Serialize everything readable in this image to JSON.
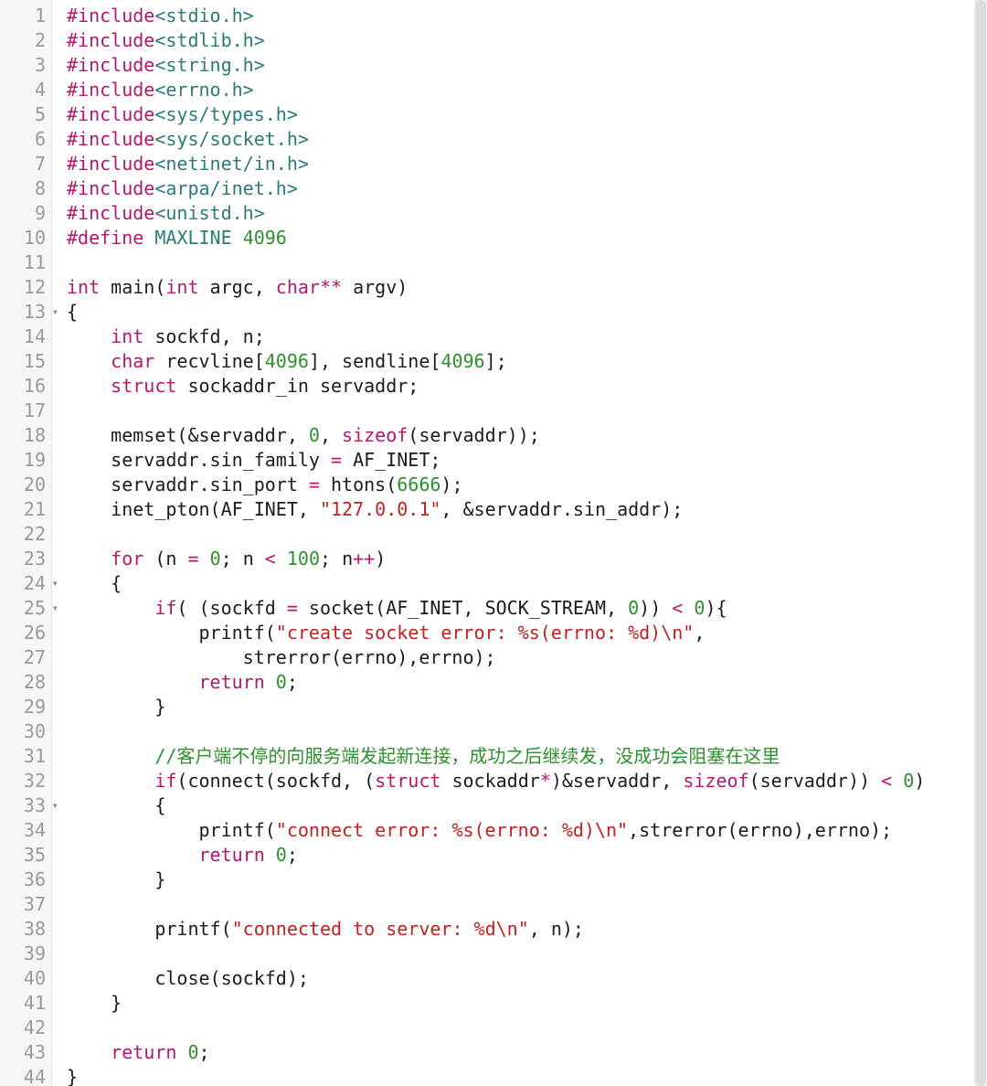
{
  "editor": {
    "line_count": 44,
    "fold_lines": [
      13,
      24,
      25,
      33
    ],
    "lines": {
      "1": [
        [
          "pp",
          "#include"
        ],
        [
          "hdr",
          "<stdio.h>"
        ]
      ],
      "2": [
        [
          "pp",
          "#include"
        ],
        [
          "hdr",
          "<stdlib.h>"
        ]
      ],
      "3": [
        [
          "pp",
          "#include"
        ],
        [
          "hdr",
          "<string.h>"
        ]
      ],
      "4": [
        [
          "pp",
          "#include"
        ],
        [
          "hdr",
          "<errno.h>"
        ]
      ],
      "5": [
        [
          "pp",
          "#include"
        ],
        [
          "hdr",
          "<sys/types.h>"
        ]
      ],
      "6": [
        [
          "pp",
          "#include"
        ],
        [
          "hdr",
          "<sys/socket.h>"
        ]
      ],
      "7": [
        [
          "pp",
          "#include"
        ],
        [
          "hdr",
          "<netinet/in.h>"
        ]
      ],
      "8": [
        [
          "pp",
          "#include"
        ],
        [
          "hdr",
          "<arpa/inet.h>"
        ]
      ],
      "9": [
        [
          "pp",
          "#include"
        ],
        [
          "hdr",
          "<unistd.h>"
        ]
      ],
      "10": [
        [
          "pp",
          "#define"
        ],
        [
          "id",
          " "
        ],
        [
          "hdr",
          "MAXLINE"
        ],
        [
          "id",
          " "
        ],
        [
          "num",
          "4096"
        ]
      ],
      "11": [
        [
          "id",
          ""
        ]
      ],
      "12": [
        [
          "kw",
          "int"
        ],
        [
          "id",
          " main("
        ],
        [
          "kw",
          "int"
        ],
        [
          "id",
          " argc, "
        ],
        [
          "kw",
          "char"
        ],
        [
          "op",
          "**"
        ],
        [
          "id",
          " argv)"
        ]
      ],
      "13": [
        [
          "id",
          "{"
        ]
      ],
      "14": [
        [
          "id",
          "    "
        ],
        [
          "kw",
          "int"
        ],
        [
          "id",
          " sockfd, n;"
        ]
      ],
      "15": [
        [
          "id",
          "    "
        ],
        [
          "kw",
          "char"
        ],
        [
          "id",
          " recvline["
        ],
        [
          "num",
          "4096"
        ],
        [
          "id",
          "], sendline["
        ],
        [
          "num",
          "4096"
        ],
        [
          "id",
          "];"
        ]
      ],
      "16": [
        [
          "id",
          "    "
        ],
        [
          "kw",
          "struct"
        ],
        [
          "id",
          " sockaddr_in servaddr;"
        ]
      ],
      "17": [
        [
          "id",
          ""
        ]
      ],
      "18": [
        [
          "id",
          "    memset(&servaddr, "
        ],
        [
          "num",
          "0"
        ],
        [
          "id",
          ", "
        ],
        [
          "kw",
          "sizeof"
        ],
        [
          "id",
          "(servaddr));"
        ]
      ],
      "19": [
        [
          "id",
          "    servaddr.sin_family "
        ],
        [
          "op",
          "="
        ],
        [
          "id",
          " AF_INET;"
        ]
      ],
      "20": [
        [
          "id",
          "    servaddr.sin_port "
        ],
        [
          "op",
          "="
        ],
        [
          "id",
          " htons("
        ],
        [
          "num",
          "6666"
        ],
        [
          "id",
          ");"
        ]
      ],
      "21": [
        [
          "id",
          "    inet_pton(AF_INET, "
        ],
        [
          "str",
          "\"127.0.0.1\""
        ],
        [
          "id",
          ", &servaddr.sin_addr);"
        ]
      ],
      "22": [
        [
          "id",
          ""
        ]
      ],
      "23": [
        [
          "id",
          "    "
        ],
        [
          "kw",
          "for"
        ],
        [
          "id",
          " (n "
        ],
        [
          "op",
          "="
        ],
        [
          "id",
          " "
        ],
        [
          "num",
          "0"
        ],
        [
          "id",
          "; n "
        ],
        [
          "op",
          "<"
        ],
        [
          "id",
          " "
        ],
        [
          "num",
          "100"
        ],
        [
          "id",
          "; n"
        ],
        [
          "op",
          "++"
        ],
        [
          "id",
          ")"
        ]
      ],
      "24": [
        [
          "id",
          "    {"
        ]
      ],
      "25": [
        [
          "id",
          "        "
        ],
        [
          "kw",
          "if"
        ],
        [
          "id",
          "( (sockfd "
        ],
        [
          "op",
          "="
        ],
        [
          "id",
          " socket(AF_INET, SOCK_STREAM, "
        ],
        [
          "num",
          "0"
        ],
        [
          "id",
          ")) "
        ],
        [
          "op",
          "<"
        ],
        [
          "id",
          " "
        ],
        [
          "num",
          "0"
        ],
        [
          "id",
          "){"
        ]
      ],
      "26": [
        [
          "id",
          "            printf("
        ],
        [
          "str",
          "\"create socket error: %s(errno: %d)\\n\""
        ],
        [
          "id",
          ","
        ]
      ],
      "27": [
        [
          "id",
          "                strerror(errno),errno);"
        ]
      ],
      "28": [
        [
          "id",
          "            "
        ],
        [
          "kw",
          "return"
        ],
        [
          "id",
          " "
        ],
        [
          "num",
          "0"
        ],
        [
          "id",
          ";"
        ]
      ],
      "29": [
        [
          "id",
          "        }"
        ]
      ],
      "30": [
        [
          "id",
          ""
        ]
      ],
      "31": [
        [
          "id",
          "        "
        ],
        [
          "cmt",
          "//客户端不停的向服务端发起新连接，成功之后继续发，没成功会阻塞在这里"
        ]
      ],
      "32": [
        [
          "id",
          "        "
        ],
        [
          "kw",
          "if"
        ],
        [
          "id",
          "(connect(sockfd, ("
        ],
        [
          "kw",
          "struct"
        ],
        [
          "id",
          " sockaddr"
        ],
        [
          "op",
          "*"
        ],
        [
          "id",
          ")&servaddr, "
        ],
        [
          "kw",
          "sizeof"
        ],
        [
          "id",
          "(servaddr)) "
        ],
        [
          "op",
          "<"
        ],
        [
          "id",
          " "
        ],
        [
          "num",
          "0"
        ],
        [
          "id",
          ")"
        ]
      ],
      "33": [
        [
          "id",
          "        {"
        ]
      ],
      "34": [
        [
          "id",
          "            printf("
        ],
        [
          "str",
          "\"connect error: %s(errno: %d)\\n\""
        ],
        [
          "id",
          ",strerror(errno),errno);"
        ]
      ],
      "35": [
        [
          "id",
          "            "
        ],
        [
          "kw",
          "return"
        ],
        [
          "id",
          " "
        ],
        [
          "num",
          "0"
        ],
        [
          "id",
          ";"
        ]
      ],
      "36": [
        [
          "id",
          "        }"
        ]
      ],
      "37": [
        [
          "id",
          ""
        ]
      ],
      "38": [
        [
          "id",
          "        printf("
        ],
        [
          "str",
          "\"connected to server: %d\\n\""
        ],
        [
          "id",
          ", n);"
        ]
      ],
      "39": [
        [
          "id",
          ""
        ]
      ],
      "40": [
        [
          "id",
          "        close(sockfd);"
        ]
      ],
      "41": [
        [
          "id",
          "    }"
        ]
      ],
      "42": [
        [
          "id",
          ""
        ]
      ],
      "43": [
        [
          "id",
          "    "
        ],
        [
          "kw",
          "return"
        ],
        [
          "id",
          " "
        ],
        [
          "num",
          "0"
        ],
        [
          "id",
          ";"
        ]
      ],
      "44": [
        [
          "id",
          "}"
        ]
      ]
    }
  },
  "fold_glyph": "▾"
}
